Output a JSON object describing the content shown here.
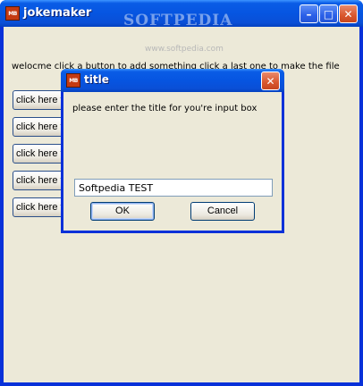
{
  "window": {
    "title": "jokemaker",
    "icon_text": "MB",
    "watermark": "SOFTPEDIA",
    "watermark_url": "www.softpedia.com",
    "controls": {
      "minimize": "–",
      "maximize": "□",
      "close": "✕"
    }
  },
  "main": {
    "welcome_text": "welocme click a button to add something click a last one to make the file",
    "buttons": [
      {
        "label": "click here to add a greeting"
      },
      {
        "label": "click here to add the joke"
      },
      {
        "label": "click here to add a punchline"
      },
      {
        "label": "click here to add an ending"
      },
      {
        "label": "click here to make the file"
      }
    ]
  },
  "dialog": {
    "title": "title",
    "icon_text": "MB",
    "close": "✕",
    "prompt": "please enter the title for you're input box",
    "input_value": "Softpedia TEST",
    "ok_label": "OK",
    "cancel_label": "Cancel"
  },
  "colors": {
    "titlebar": "#0a5ce6",
    "close_button": "#d9572d",
    "client_bg": "#ece9d8",
    "input_border": "#7f9db9"
  }
}
